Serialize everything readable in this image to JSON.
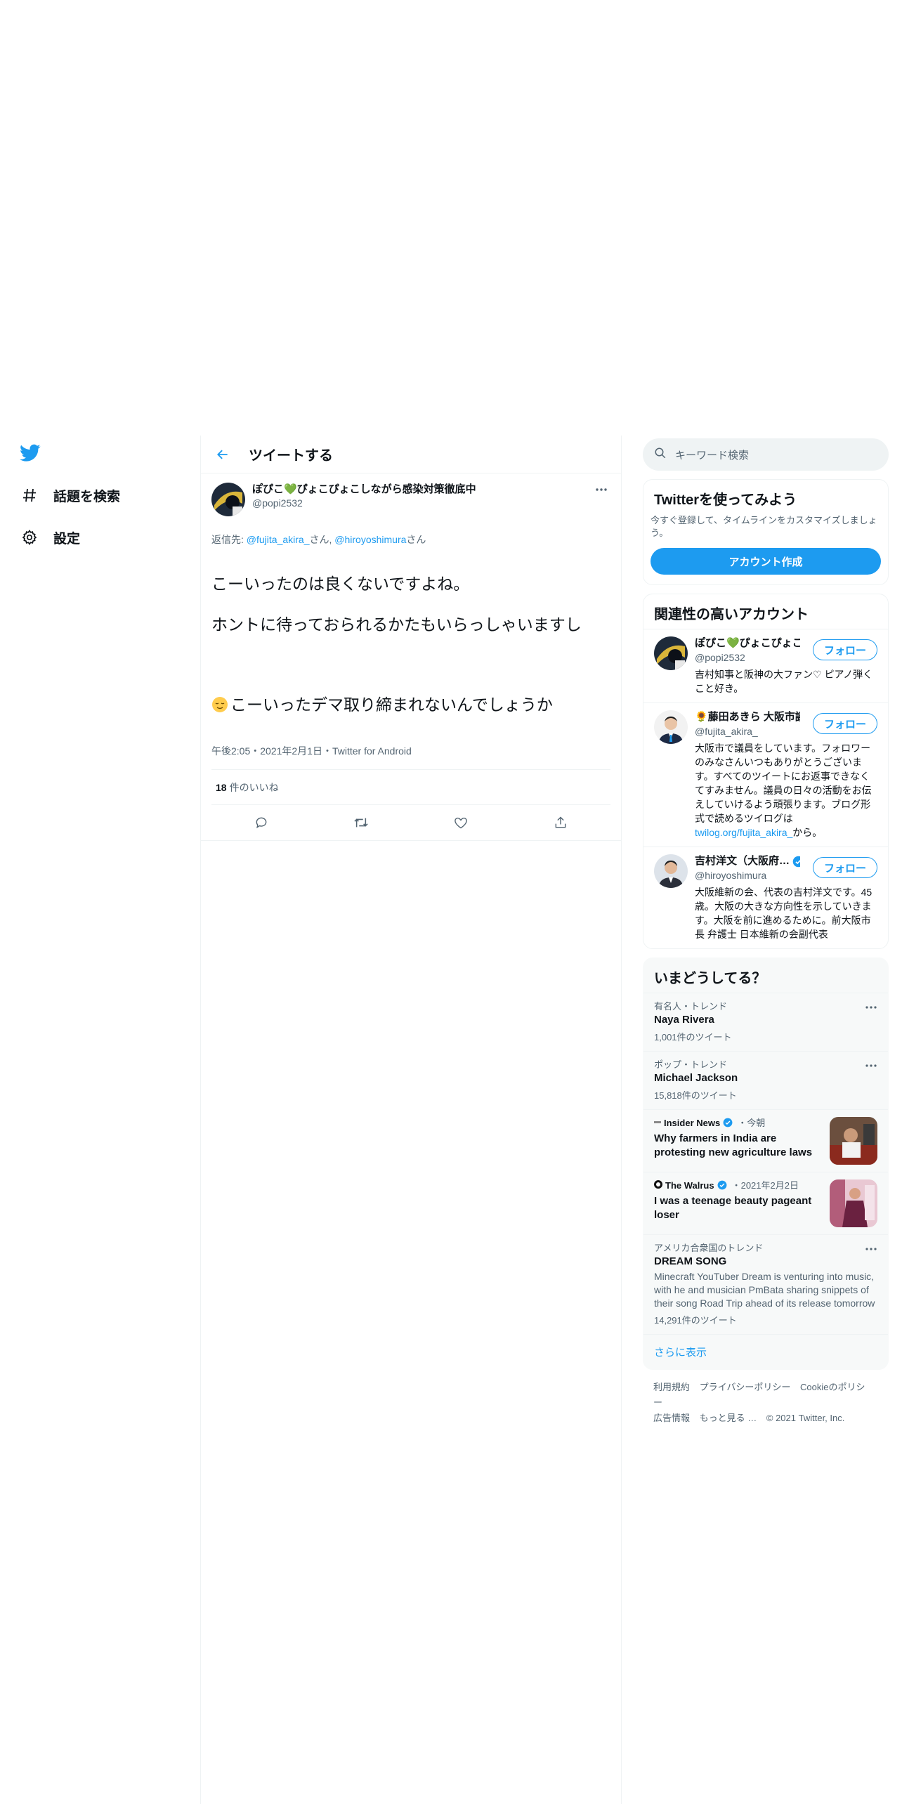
{
  "colors": {
    "accent": "#1d9bf0",
    "text": "#0f1419",
    "secondary": "#536471"
  },
  "nav": {
    "logo_icon": "twitter-bird-icon",
    "items": [
      {
        "label": "話題を検索",
        "icon": "hashtag-icon"
      },
      {
        "label": "設定",
        "icon": "gear-icon"
      }
    ]
  },
  "header": {
    "title": "ツイートする"
  },
  "tweet": {
    "author_name": "ぽぴこ💚ぴょこぴょこしながら感染対策徹底中",
    "author_handle": "@popi2532",
    "reply_prefix": "返信先: ",
    "reply_user1": "@fujita_akira_",
    "reply_mid": "さん, ",
    "reply_user2": "@hiroyoshimura",
    "reply_suffix": "さん",
    "text_line1": "こーいったのは良くないですよね。",
    "text_line2": "ホントに待っておられるかたもいらっしゃいますし",
    "text_line3": "こーいったデマ取り締まれないんでしょうか",
    "meta": "午後2:05・2021年2月1日・Twitter for Android",
    "likes_count": "18",
    "likes_label": "件のいいね"
  },
  "search": {
    "placeholder": "キーワード検索"
  },
  "signup": {
    "title": "Twitterを使ってみよう",
    "subtitle": "今すぐ登録して、タイムラインをカスタマイズしましょう。",
    "button": "アカウント作成"
  },
  "related": {
    "title": "関連性の高いアカウント",
    "follow_label": "フォロー",
    "accounts": [
      {
        "name": "ぽぴこ💚ぴょこぴょこしながら…",
        "handle": "@popi2532",
        "bio": "吉村知事と阪神の大ファン♡ ピアノ弾くこと好き。"
      },
      {
        "name": "🌻藤田あきら 大阪市議",
        "handle": "@fujita_akira_",
        "bio": "大阪市で議員をしています。フォロワーのみなさんいつもありがとうございます。すべてのツイートにお返事できなくてすみません。議員の日々の活動をお伝えしていけるよう頑張ります。ブログ形式で読めるツイログは",
        "bio_link": "twilog.org/fujita_akira_",
        "bio_after": "から。"
      },
      {
        "name": "吉村洋文（大阪府…",
        "handle": "@hiroyoshimura",
        "bio": "大阪維新の会、代表の吉村洋文です。45歳。大阪の大きな方向性を示していきます。大阪を前に進めるために。前大阪市長 弁護士 日本維新の会副代表"
      }
    ]
  },
  "trends": {
    "title": "いまどうしてる？",
    "items": [
      {
        "context": "有名人・トレンド",
        "name": "Naya Rivera",
        "count": "1,001件のツイート"
      },
      {
        "context": "ポップ・トレンド",
        "name": "Michael Jackson",
        "count": "15,818件のツイート"
      }
    ],
    "news": [
      {
        "source": "Insider News",
        "time": "・今朝",
        "title": "Why farmers in India are protesting new agriculture laws"
      },
      {
        "source": "The Walrus",
        "time": "・2021年2月2日",
        "title": "I was a teenage beauty pageant loser"
      }
    ],
    "last": {
      "context": "アメリカ合衆国のトレンド",
      "name": "DREAM SONG",
      "desc": "Minecraft YouTuber Dream is venturing into music, with he and musician PmBata sharing snippets of their song Road Trip ahead of its release tomorrow",
      "count": "14,291件のツイート"
    },
    "show_more": "さらに表示"
  },
  "footer": {
    "links": [
      "利用規約",
      "プライバシーポリシー",
      "Cookieのポリシー"
    ],
    "links2": [
      "広告情報",
      "もっと見る …"
    ],
    "copyright": "© 2021 Twitter, Inc."
  }
}
